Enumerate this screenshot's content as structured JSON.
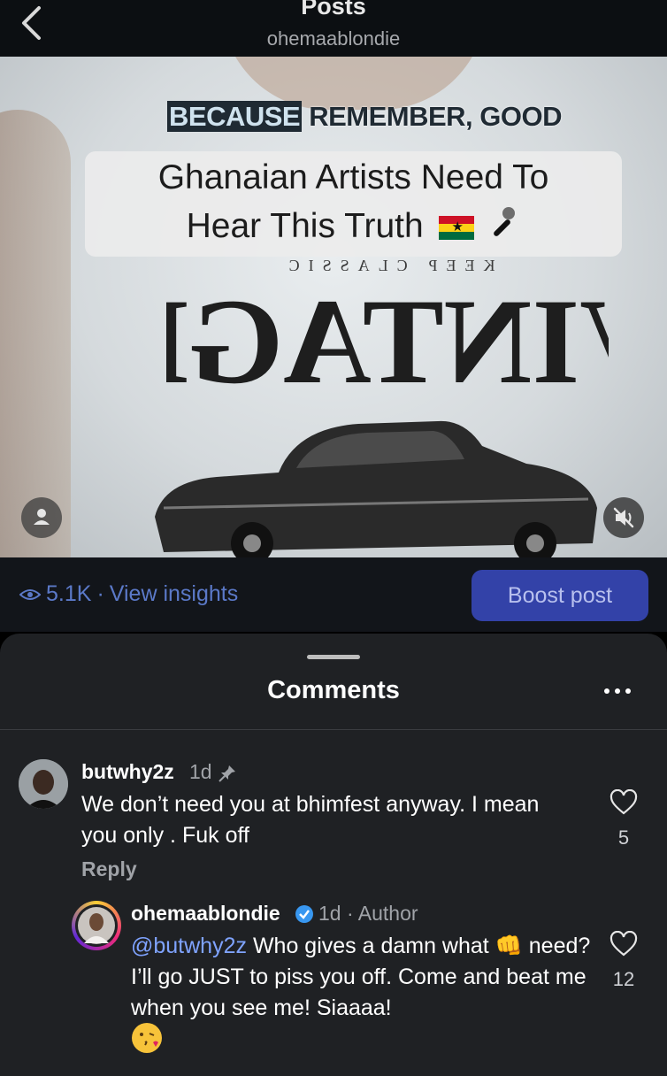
{
  "header": {
    "title": "Posts",
    "username": "ohemaablondie"
  },
  "media": {
    "caption_top": {
      "word1": "BECAUSE",
      "rest": "REMEMBER, GOOD"
    },
    "caption_box": {
      "line1": "Ghanaian Artists Need To",
      "line2": "Hear This Truth"
    },
    "shirt_small_text": "KEEP CLASSIC",
    "shirt_big_text": "VINTAGE"
  },
  "insights": {
    "views": "5.1K",
    "separator": "·",
    "view_insights_label": "View insights",
    "boost_label": "Boost post"
  },
  "comments": {
    "title": "Comments",
    "items": [
      {
        "username": "butwhy2z",
        "time": "1d",
        "pinned": true,
        "text": "We don’t need you at bhimfest anyway. I mean you only . Fuk off",
        "reply_label": "Reply",
        "likes": "5"
      },
      {
        "username": "ohemaablondie",
        "verified": true,
        "time": "1d",
        "role": "Author",
        "mention": "@butwhy2z",
        "text": " Who gives a damn what 👊 need? I’ll go JUST to piss you off. Come and beat me when you see me! Siaaaa!",
        "likes": "12"
      }
    ]
  },
  "colors": {
    "accent": "#3342a8",
    "link": "#5b79c8",
    "sheet_bg": "#1f2124"
  }
}
